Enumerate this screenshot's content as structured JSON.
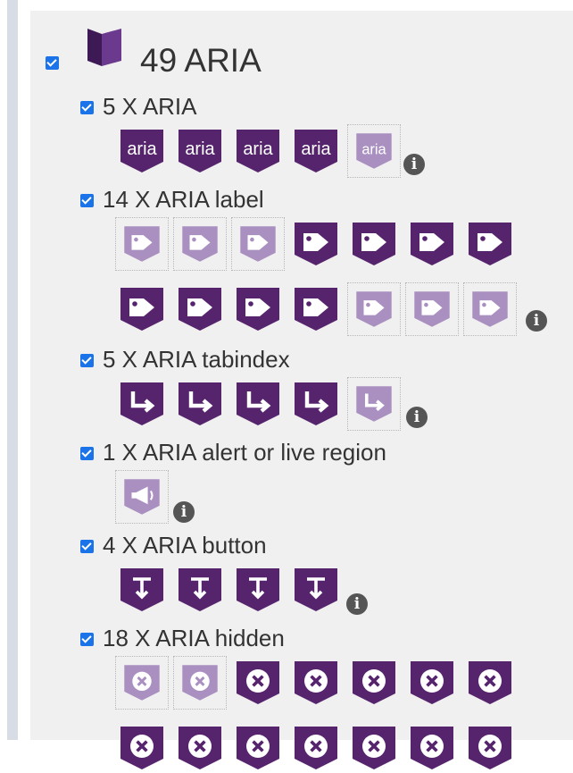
{
  "group": {
    "count_label": "49 ARIA",
    "checked": true,
    "icon": "aria-purple-box-icon"
  },
  "categories": [
    {
      "key": "aria",
      "label": "5 X ARIA",
      "icon": "aria-text-icon",
      "count": 5,
      "dimmed": [
        5
      ]
    },
    {
      "key": "label",
      "label": "14 X ARIA label",
      "icon": "aria-label-tag-icon",
      "count": 14,
      "dimmed": [
        1,
        2,
        3,
        12,
        13,
        14
      ]
    },
    {
      "key": "tabindex",
      "label": "5 X ARIA tabindex",
      "icon": "aria-tabindex-arrow-icon",
      "count": 5,
      "dimmed": [
        5
      ]
    },
    {
      "key": "alert",
      "label": "1 X ARIA alert or live region",
      "icon": "aria-alert-megaphone-icon",
      "count": 1,
      "dimmed": [
        1
      ]
    },
    {
      "key": "button",
      "label": "4 X ARIA button",
      "icon": "aria-button-pointer-icon",
      "count": 4,
      "dimmed": []
    },
    {
      "key": "hidden",
      "label": "18 X ARIA hidden",
      "icon": "aria-hidden-x-icon",
      "count": 18,
      "dimmed": [
        1,
        2
      ]
    }
  ],
  "icon_text": {
    "aria": "aria"
  },
  "colors": {
    "icon_fill": "#56246d",
    "icon_dim_fill": "#aa90c0",
    "checkbox": "#1a73e8",
    "info": "#555555"
  }
}
